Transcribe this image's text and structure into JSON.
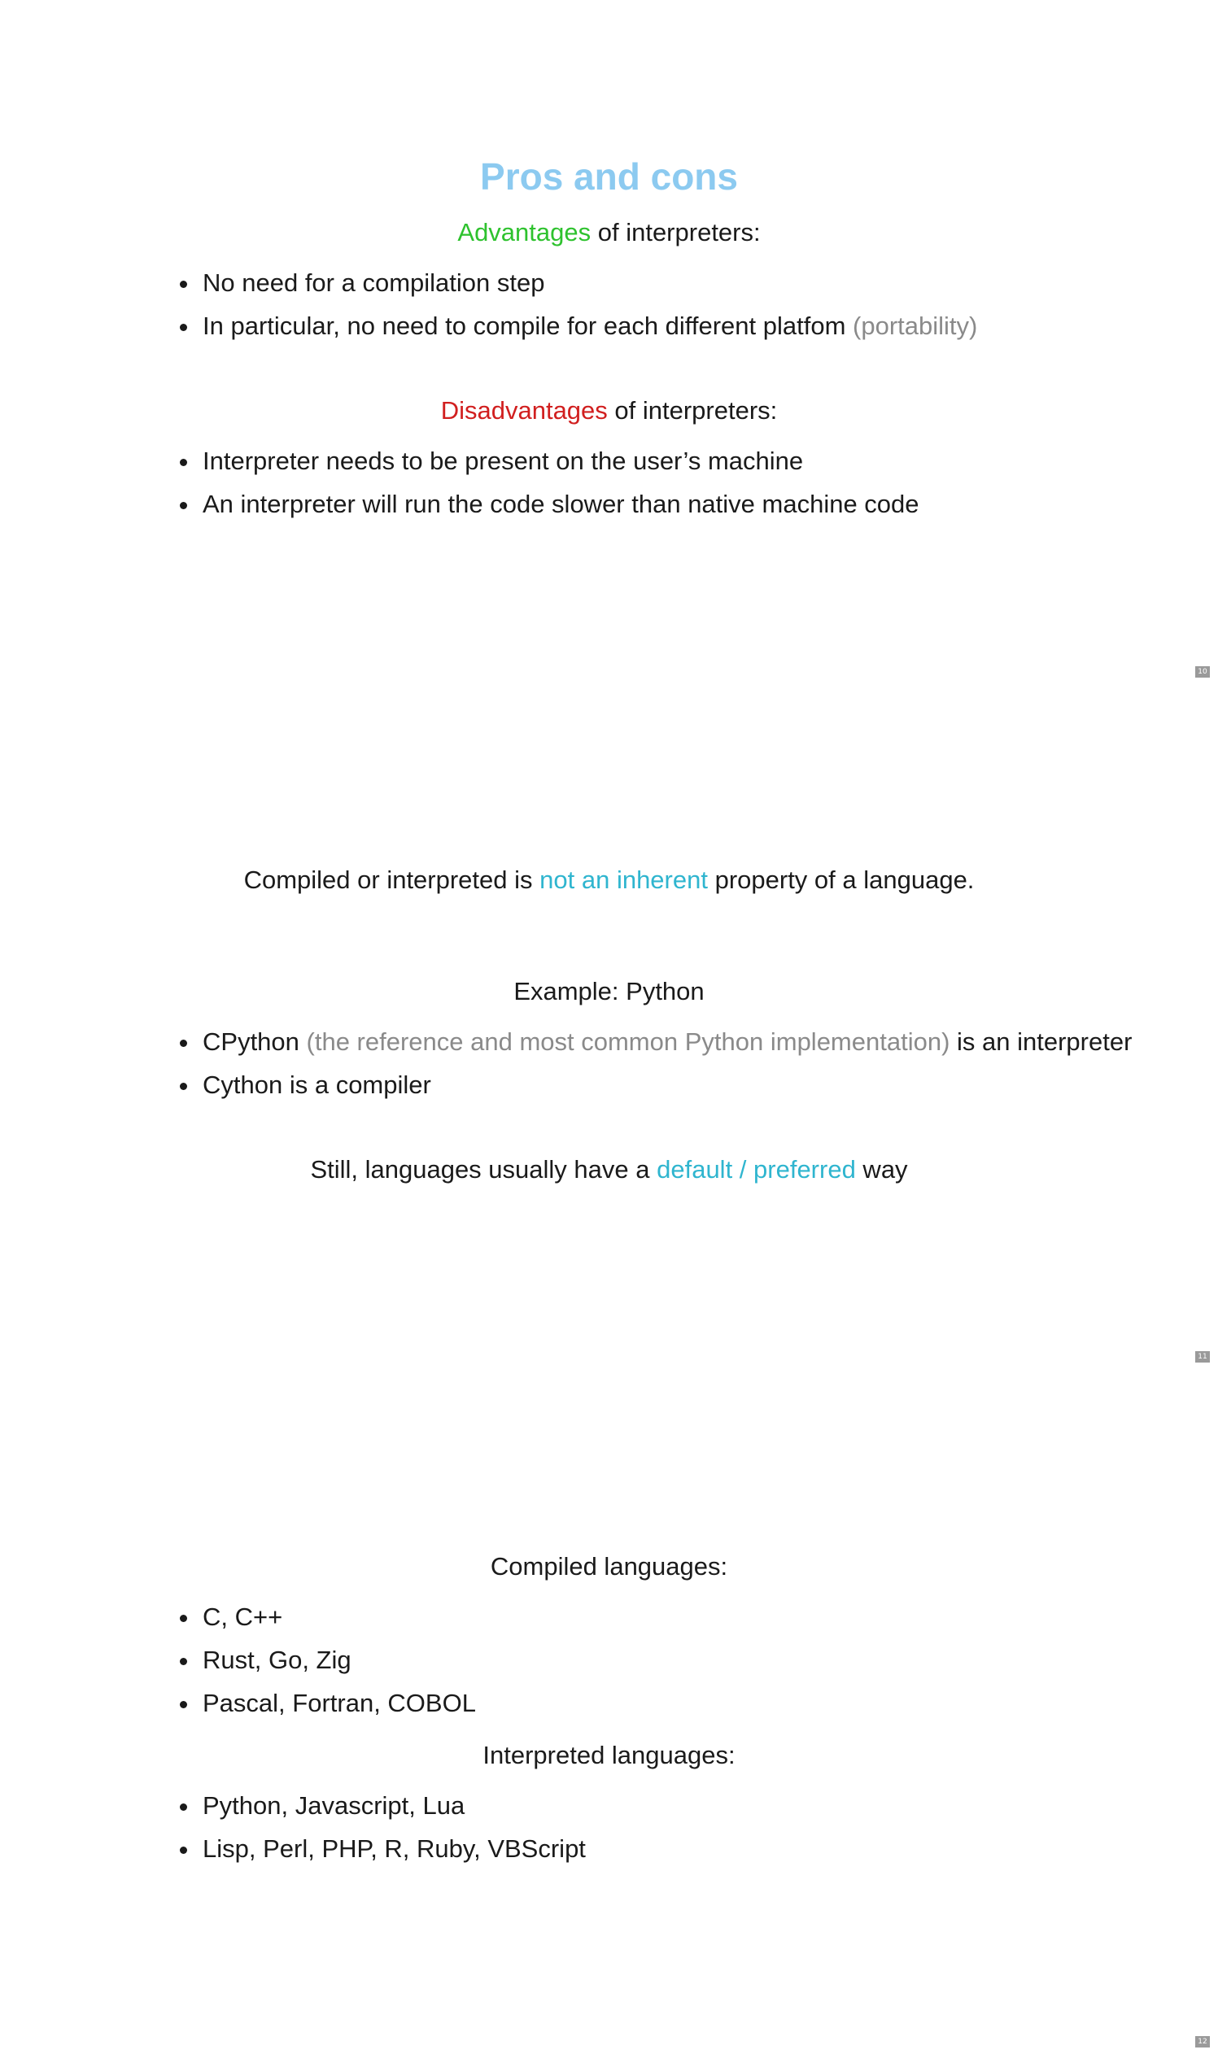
{
  "slides": [
    {
      "page_number": "10",
      "title": "Pros and cons",
      "advantages_heading": {
        "highlight": "Advantages",
        "rest": " of interpreters:"
      },
      "advantages": [
        {
          "text": "No need for a compilation step",
          "note": ""
        },
        {
          "text": "In particular, no need to compile for each different platfom ",
          "note": "(portability)"
        }
      ],
      "disadvantages_heading": {
        "highlight": "Disadvantages",
        "rest": " of interpreters:"
      },
      "disadvantages": [
        {
          "text": "Interpreter needs to be present on the user’s machine"
        },
        {
          "text": "An interpreter will run the code slower than native machine code"
        }
      ]
    },
    {
      "page_number": "11",
      "statement": {
        "before": "Compiled or interpreted is ",
        "highlight": "not an inherent",
        "after": " property of a language."
      },
      "example_heading": "Example: Python",
      "examples": [
        {
          "before": "CPython ",
          "note": "(the reference and most common Python implementation)",
          "after": " is an interpreter"
        },
        {
          "before": "Cython is a compiler",
          "note": "",
          "after": ""
        }
      ],
      "conclusion": {
        "before": "Still, languages usually have a ",
        "highlight": "default / preferred",
        "after": " way"
      }
    },
    {
      "page_number": "12",
      "compiled_heading": "Compiled languages:",
      "compiled": [
        "C, C++",
        "Rust, Go, Zig",
        "Pascal, Fortran, COBOL"
      ],
      "interpreted_heading": "Interpreted languages:",
      "interpreted": [
        "Python, Javascript, Lua",
        "Lisp, Perl, PHP, R, Ruby, VBScript"
      ]
    }
  ],
  "colors": {
    "title": "#8ccaf0",
    "advantages": "#2ec22e",
    "disadvantages": "#d11f1f",
    "note": "#8a8a8a",
    "highlight": "#2fb5cf",
    "text": "#1a1a1a"
  }
}
